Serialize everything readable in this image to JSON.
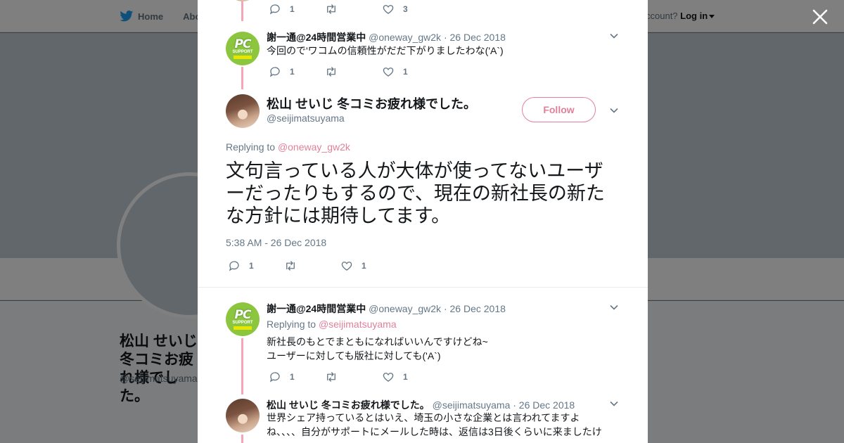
{
  "background": {
    "nav": {
      "home_label": "Home",
      "about_label": "Abo"
    },
    "login": {
      "prompt": "ccount?",
      "login_label": "Log in"
    },
    "profile": {
      "name": "松山 せいじ冬コミお疲れ様でした。",
      "handle": "@seijimatsuyama"
    }
  },
  "modal": {
    "top_actions": {
      "reply_count": "1",
      "retweet_count": "",
      "like_count": "3"
    },
    "tweet1": {
      "name": "謝一通@24時間営業中",
      "handle": "@oneway_gw2k",
      "date": "· 26 Dec 2018",
      "text": "今回ので'ワコムの信頼性がだだ下がりましたわな('A`)",
      "reply_count": "1",
      "retweet_count": "",
      "like_count": "1"
    },
    "main": {
      "name": "松山 せいじ 冬コミお疲れ様でした。",
      "handle": "@seijimatsuyama",
      "follow_label": "Follow",
      "replying_prefix": "Replying to",
      "replying_to": "@oneway_gw2k",
      "text": "文句言っている人が大体が使ってないユーザーだったりもするので、現在の新社長の新たな方針には期待してます。",
      "timestamp": "5:38 AM - 26 Dec 2018",
      "reply_count": "1",
      "retweet_count": "",
      "like_count": "1"
    },
    "tweet3": {
      "name": "謝一通@24時間営業中",
      "handle": "@oneway_gw2k",
      "date": "· 26 Dec 2018",
      "replying_prefix": "Replying to",
      "replying_to": "@seijimatsuyama",
      "text_line1": "新社長のもとでまともになればいいんですけどね~",
      "text_line2": "ユーザーに対しても版社に対しても('A`)",
      "reply_count": "1",
      "retweet_count": "",
      "like_count": "1"
    },
    "tweet4": {
      "name": "松山 せいじ 冬コミお疲れ様でした。",
      "handle": "@seijimatsuyama",
      "date": "· 26 Dec 2018",
      "text_line1": "世界シェア持っているとはいえ、埼玉の小さな企業とは言われてますよ",
      "text_line2": "ね、、、、自分がサポートにメールした時は、返信は3日後くらいに来ましたけ"
    },
    "colors": {
      "accent": "#e0809b",
      "thread_line": "#f4a6b8",
      "twitter_blue": "#1da1f2"
    }
  }
}
